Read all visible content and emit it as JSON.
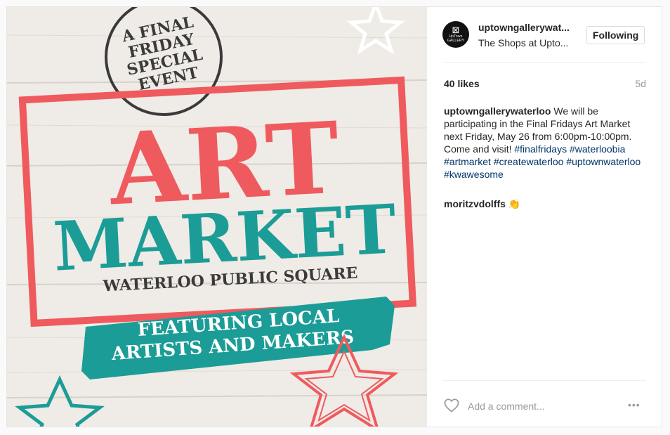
{
  "poster": {
    "badge_line1": "A FINAL",
    "badge_line2": "FRIDAY",
    "badge_line3": "SPECIAL",
    "badge_line4": "EVENT",
    "title_line1": "ART",
    "title_line2": "MARKET",
    "venue": "WATERLOO PUBLIC SQUARE",
    "banner_line1": "FEATURING LOCAL",
    "banner_line2": "ARTISTS AND MAKERS",
    "colors": {
      "red": "#ef5a5e",
      "teal": "#1c9c96",
      "dark": "#3b3a3a",
      "wood": "#f1ede8"
    }
  },
  "header": {
    "avatar_line1": "UpTown",
    "avatar_line2": "GALLERY",
    "username": "uptowngallerywat...",
    "location": "The Shops at Upto...",
    "follow_label": "Following"
  },
  "stats": {
    "likes": "40 likes",
    "time": "5d"
  },
  "caption": {
    "username": "uptowngallerywaterloo",
    "text": "We will be participating in the Final Fridays Art Market next Friday, May 26 from 6:00pm-10:00pm. Come and visit!",
    "hashtags": [
      "#finalfridays",
      "#waterloobia",
      "#artmarket",
      "#createwaterloo",
      "#uptownwaterloo",
      "#kwawesome"
    ]
  },
  "comment": {
    "username": "moritzvdolffs",
    "emoji": "👏"
  },
  "footer": {
    "placeholder": "Add a comment...",
    "more": "•••",
    "icons": {
      "like": "heart-icon",
      "more": "more-options-icon"
    }
  }
}
